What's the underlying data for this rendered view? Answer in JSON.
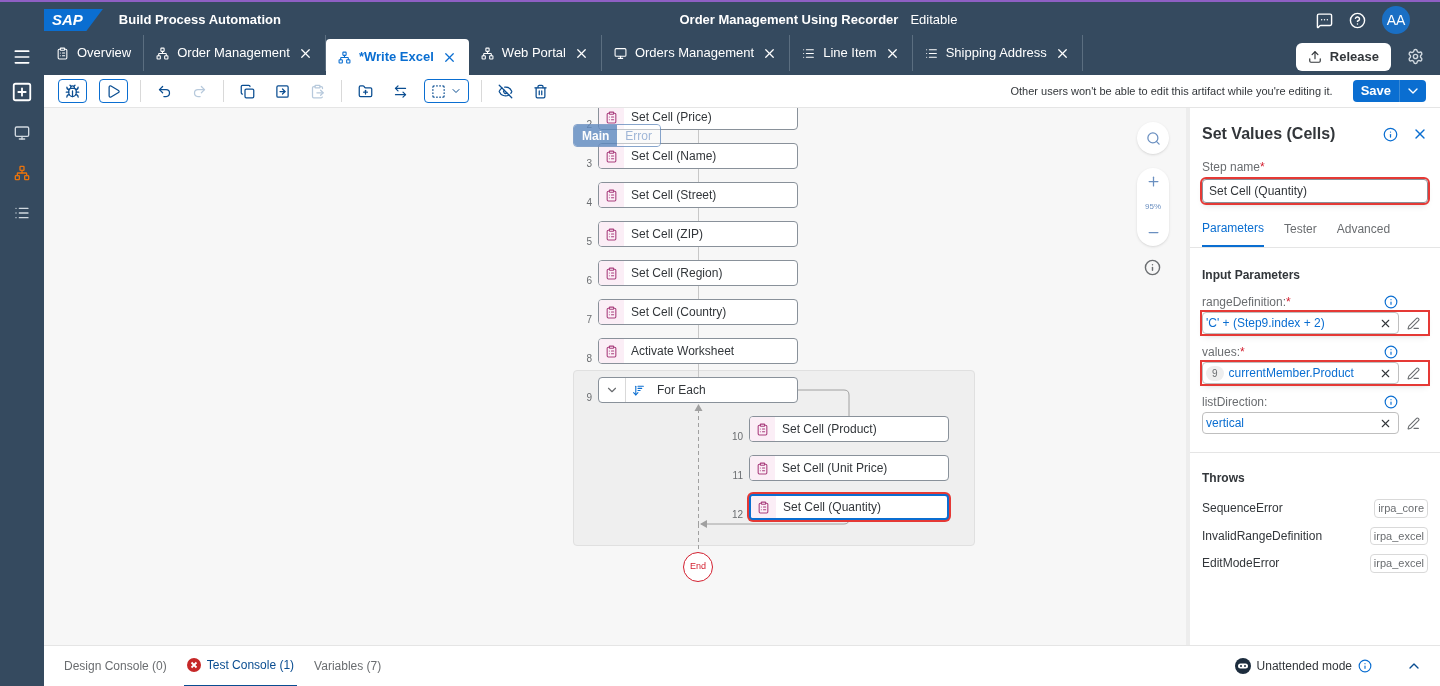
{
  "header": {
    "logo": "SAP",
    "product": "Build Process Automation",
    "project": "Order Management Using Recorder",
    "mode": "Editable",
    "avatar": "AA"
  },
  "rail": [
    {
      "kind": "monitor",
      "selected": false
    },
    {
      "kind": "flow",
      "selected": true
    },
    {
      "kind": "list",
      "selected": false
    }
  ],
  "tabs": [
    {
      "kind": "overview",
      "label": "Overview",
      "closable": false,
      "selected": false
    },
    {
      "kind": "flow",
      "label": "Order Management",
      "closable": true,
      "selected": false
    },
    {
      "kind": "flow",
      "label": "*Write Excel",
      "closable": true,
      "selected": true
    },
    {
      "kind": "flow",
      "label": "Web Portal",
      "closable": true,
      "selected": false
    },
    {
      "kind": "screen",
      "label": "Orders Management",
      "closable": true,
      "selected": false
    },
    {
      "kind": "list",
      "label": "Line Item",
      "closable": true,
      "selected": false
    },
    {
      "kind": "list",
      "label": "Shipping Address",
      "closable": true,
      "selected": false
    }
  ],
  "release_button": "Release",
  "toolbar": [
    {
      "kind": "debug",
      "disabled": false
    },
    {
      "kind": "run",
      "disabled": false
    },
    {
      "kind": "undo",
      "disabled": false
    },
    {
      "kind": "redo",
      "disabled": true
    },
    {
      "kind": "copy",
      "disabled": false
    },
    {
      "kind": "duplicate",
      "disabled": false
    },
    {
      "kind": "paste",
      "disabled": true
    },
    {
      "kind": "group",
      "disabled": false
    },
    {
      "kind": "swap",
      "disabled": false
    },
    {
      "kind": "select",
      "disabled": false
    },
    {
      "kind": "hide",
      "disabled": false
    },
    {
      "kind": "delete",
      "disabled": false
    }
  ],
  "notice": "Other users won't be able to edit this artifact while you're editing it.",
  "save_button": "Save",
  "canvas": {
    "view_toggle": [
      {
        "label": "Main",
        "selected": true
      },
      {
        "label": "Error",
        "selected": false
      }
    ],
    "zoom": "95%",
    "steps": [
      {
        "number": "2",
        "label": "Set Cell (Price)",
        "kind": "step",
        "selected": false
      },
      {
        "number": "3",
        "label": "Set Cell (Name)",
        "kind": "step",
        "selected": false
      },
      {
        "number": "4",
        "label": "Set Cell (Street)",
        "kind": "step",
        "selected": false
      },
      {
        "number": "5",
        "label": "Set Cell (ZIP)",
        "kind": "step",
        "selected": false
      },
      {
        "number": "6",
        "label": "Set Cell (Region)",
        "kind": "step",
        "selected": false
      },
      {
        "number": "7",
        "label": "Set Cell (Country)",
        "kind": "step",
        "selected": false
      },
      {
        "number": "8",
        "label": "Activate Worksheet",
        "kind": "step",
        "selected": false
      },
      {
        "number": "9",
        "label": "For Each",
        "kind": "loop",
        "selected": false,
        "children": [
          {
            "number": "10",
            "label": "Set Cell (Product)",
            "kind": "step",
            "selected": false
          },
          {
            "number": "11",
            "label": "Set Cell (Unit Price)",
            "kind": "step",
            "selected": false
          },
          {
            "number": "12",
            "label": "Set Cell (Quantity)",
            "kind": "step",
            "selected": true
          }
        ]
      }
    ],
    "end": "End"
  },
  "panel": {
    "title": "Set Values (Cells)",
    "step_name_label": "Step name",
    "step_name_mark": "*",
    "step_name": "Set Cell (Quantity)",
    "step_name_highlighted": true,
    "tabs": [
      {
        "label": "Parameters",
        "selected": true
      },
      {
        "label": "Tester",
        "selected": false
      },
      {
        "label": "Advanced",
        "selected": false
      }
    ],
    "input_title": "Input Parameters",
    "params": [
      {
        "name": "rangeDefinition:",
        "required_mark": "*",
        "value": "'C' + (Step9.index + 2)",
        "highlighted": true
      },
      {
        "name": "values:",
        "required_mark": "*",
        "badge": "9",
        "value": "currentMember.Product",
        "highlighted": true
      },
      {
        "name": "listDirection:",
        "value": "vertical",
        "highlighted": false
      }
    ],
    "throws_title": "Throws",
    "throws": [
      {
        "name": "SequenceError",
        "tag": "irpa_core"
      },
      {
        "name": "InvalidRangeDefinition",
        "tag": "irpa_excel"
      },
      {
        "name": "EditModeError",
        "tag": "irpa_excel"
      }
    ]
  },
  "console_tabs": [
    {
      "label": "Design Console (0)",
      "error": false,
      "selected": false
    },
    {
      "label": "Test Console (1)",
      "error": true,
      "selected": true
    },
    {
      "label": "Variables (7)",
      "error": false,
      "selected": false
    }
  ],
  "mode_label": "Unattended mode"
}
